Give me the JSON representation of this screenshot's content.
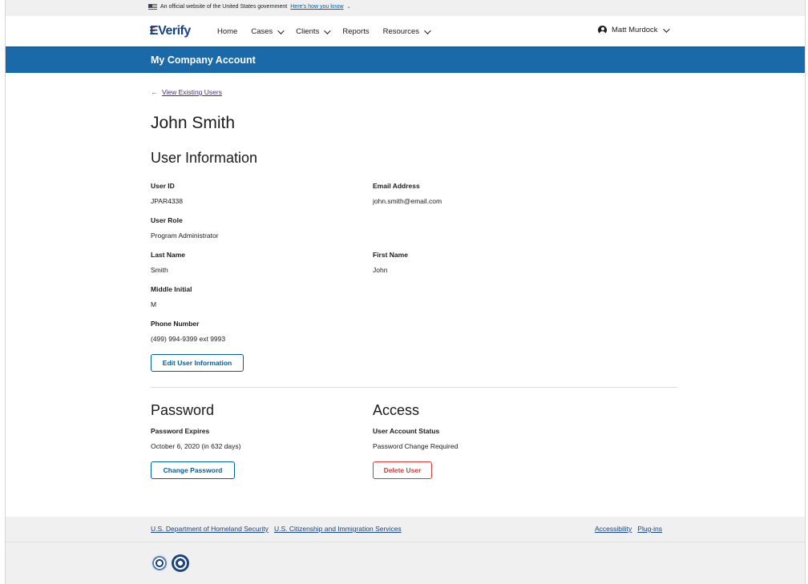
{
  "gov_banner": {
    "text": "An official website of the United States government",
    "link": "Here's how you know"
  },
  "header": {
    "logo": "Verify",
    "logo_prefix": "E",
    "nav": [
      {
        "label": "Home",
        "dropdown": false
      },
      {
        "label": "Cases",
        "dropdown": true
      },
      {
        "label": "Clients",
        "dropdown": true
      },
      {
        "label": "Reports",
        "dropdown": false
      },
      {
        "label": "Resources",
        "dropdown": true
      }
    ],
    "user": "Matt Murdock"
  },
  "band": {
    "title": "My Company Account"
  },
  "main": {
    "back_link": "View Existing Users",
    "user_name": "John Smith",
    "user_info": {
      "title": "User Information",
      "user_id_label": "User ID",
      "user_id": "JPAR4338",
      "email_label": "Email Address",
      "email": "john.smith@email.com",
      "role_label": "User Role",
      "role": "Program Administrator",
      "last_name_label": "Last Name",
      "last_name": "Smith",
      "first_name_label": "First Name",
      "first_name": "John",
      "middle_initial_label": "Middle Initial",
      "middle_initial": "M",
      "phone_label": "Phone Number",
      "phone": "(499) 994-9399 ext 9993",
      "edit_button": "Edit User Information"
    },
    "password": {
      "title": "Password",
      "expires_label": "Password Expires",
      "expires": "October 6, 2020 (in 632 days)",
      "change_button": "Change Password"
    },
    "access": {
      "title": "Access",
      "status_label": "User Account Status",
      "status": "Password Change Required",
      "delete_button": "Delete User"
    }
  },
  "footer": {
    "links_left": [
      "U.S. Department of Homeland Security",
      "U.S. Citizenship and Immigration Services"
    ],
    "links_right": [
      "Accessibility",
      "Plug-ins"
    ]
  },
  "colors": {
    "band": "#1a69a8",
    "link": "#005ea2",
    "danger": "#d83933",
    "brand": "#1a4480"
  }
}
